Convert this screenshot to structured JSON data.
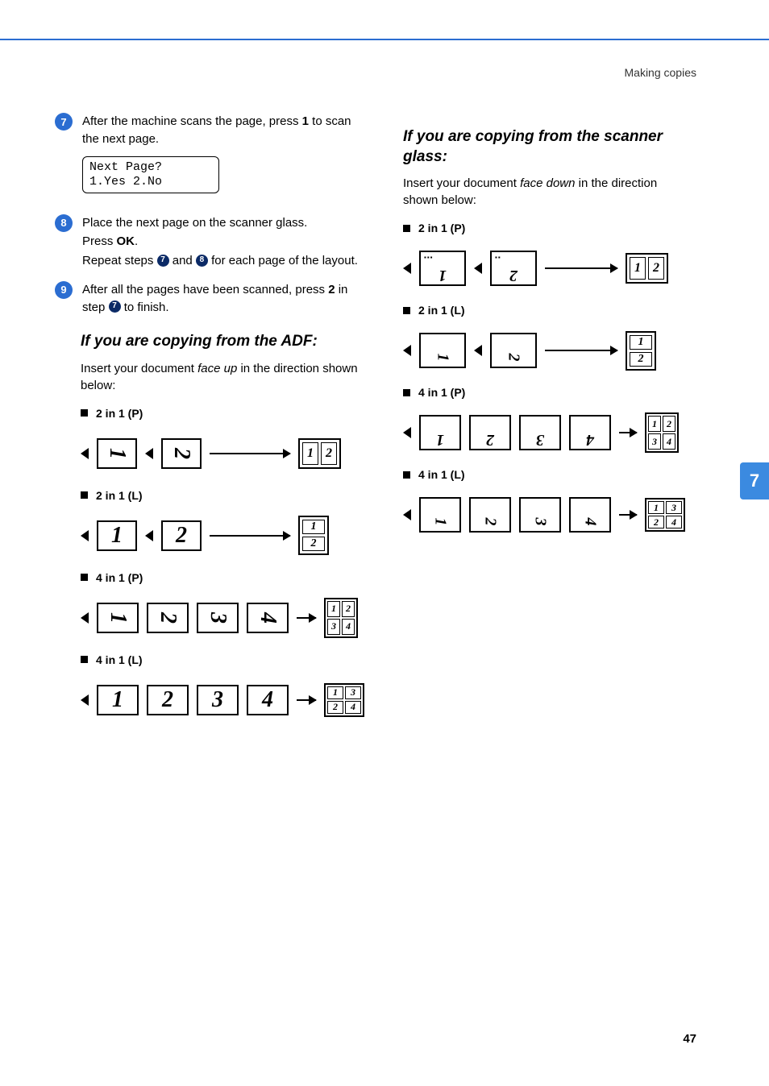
{
  "header": {
    "section": "Making copies"
  },
  "chapterTab": "7",
  "pageNumber": "47",
  "steps": {
    "s7": {
      "num": "7",
      "textA": "After the machine scans the page, press ",
      "key": "1",
      "textB": " to scan the next page.",
      "lcd1": "Next Page?",
      "lcd2": "1.Yes 2.No"
    },
    "s8": {
      "num": "8",
      "l1": "Place the next page on the scanner glass.",
      "l2a": "Press ",
      "l2key": "OK",
      "l2b": ".",
      "l3a": "Repeat steps ",
      "l3b": " and ",
      "l3c": " for each page of the layout.",
      "ref7": "7",
      "ref8": "8"
    },
    "s9": {
      "num": "9",
      "a": "After all the pages have been scanned, press ",
      "key": "2",
      "b": " in step ",
      "ref7": "7",
      "c": " to finish."
    }
  },
  "adf": {
    "heading": "If you are copying from the ADF:",
    "sub1": "Insert your document ",
    "subItalic": "face up",
    "sub2": " in the direction shown below:",
    "layouts": {
      "p2": "2 in 1 (P)",
      "l2": "2 in 1 (L)",
      "p4": "4 in 1 (P)",
      "l4": "4 in 1 (L)"
    }
  },
  "scanner": {
    "heading": "If you are copying from the scanner glass:",
    "sub1": "Insert your document ",
    "subItalic": "face down",
    "sub2": " in the direction shown below:",
    "layouts": {
      "p2": "2 in 1 (P)",
      "l2": "2 in 1 (L)",
      "p4": "4 in 1 (P)",
      "l4": "4 in 1 (L)"
    }
  },
  "nums": {
    "n1": "1",
    "n2": "2",
    "n3": "3",
    "n4": "4"
  }
}
